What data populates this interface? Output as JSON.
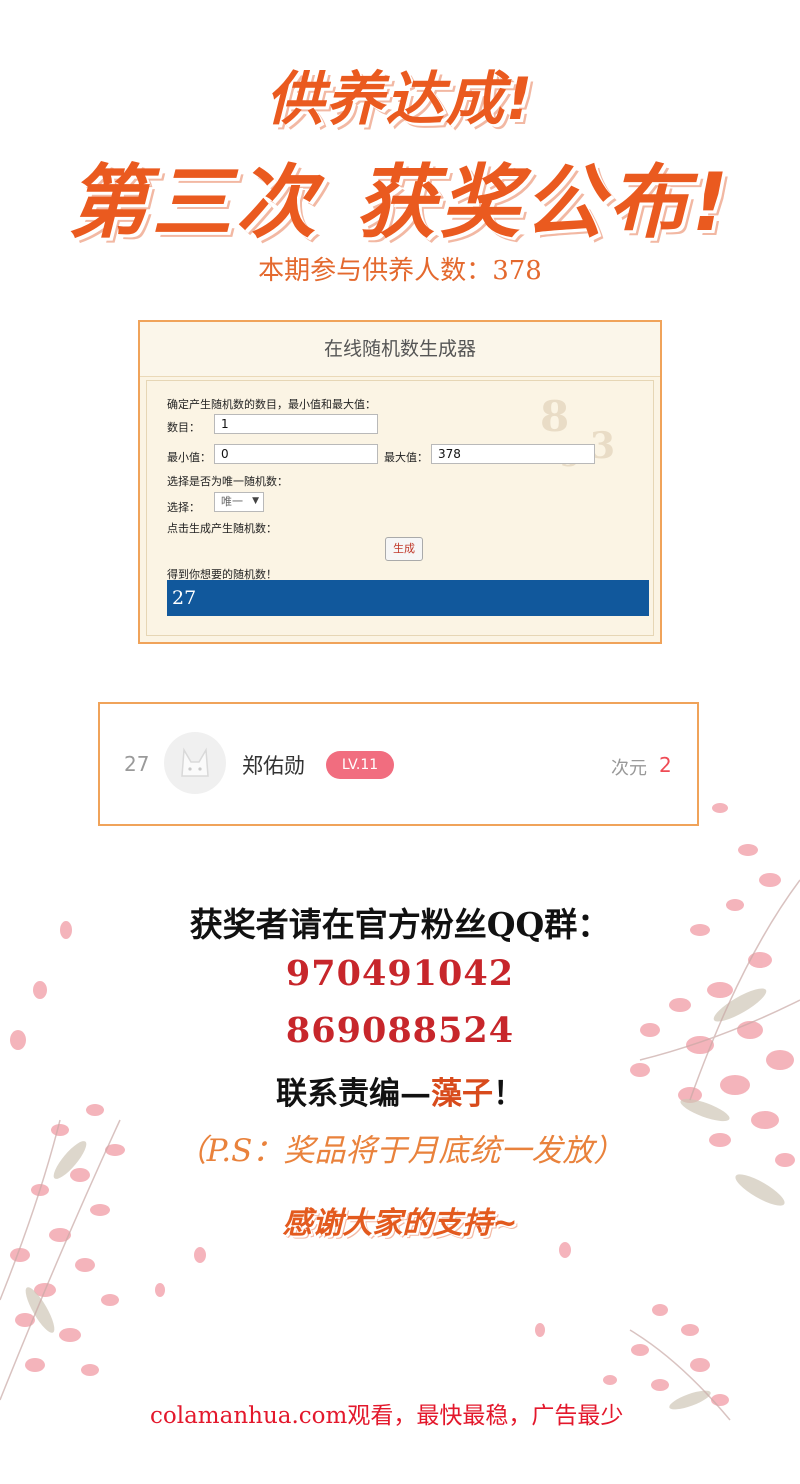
{
  "header": {
    "title_line1": "供养达成!",
    "title_line2_left": "第三次",
    "title_line2_right": "获奖公布!",
    "participants_label": "本期参与供养人数：",
    "participants_count": "378"
  },
  "rng_tool": {
    "title": "在线随机数生成器",
    "instruction": "确定产生随机数的数目，最小值和最大值：",
    "count_label": "数目：",
    "count_value": "1",
    "min_label": "最小值：",
    "min_value": "0",
    "max_label": "最大值：",
    "max_value": "378",
    "unique_prompt": "选择是否为唯一随机数：",
    "select_label": "选择：",
    "select_value": "唯一",
    "generate_prompt": "点击生成产生随机数：",
    "generate_button": "生成",
    "result_label": "得到你想要的随机数！",
    "result_value": "27"
  },
  "winner": {
    "rank": "27",
    "name": "郑佑勋",
    "level": "LV.11",
    "dim_label": "次元",
    "dim_value": "2"
  },
  "contact": {
    "qq_line": "获奖者请在官方粉丝QQ群：",
    "qq_group_1": "970491042",
    "qq_group_2": "869088524",
    "editor_prefix": "联系责编—",
    "editor_name": "藻子",
    "editor_suffix": "！",
    "ps_note": "（P.S：奖品将于月底统一发放）",
    "thanks": "感谢大家的支持~"
  },
  "footer": {
    "watermark": "colamanhua.com观看，最快最稳，广告最少"
  },
  "colors": {
    "title_orange": "#ea5a1f",
    "panel_border": "#f0a35a",
    "result_blue": "#11589c",
    "badge_pink": "#f16d7f",
    "qq_red": "#c7262b",
    "watermark_red": "#e3182c"
  }
}
